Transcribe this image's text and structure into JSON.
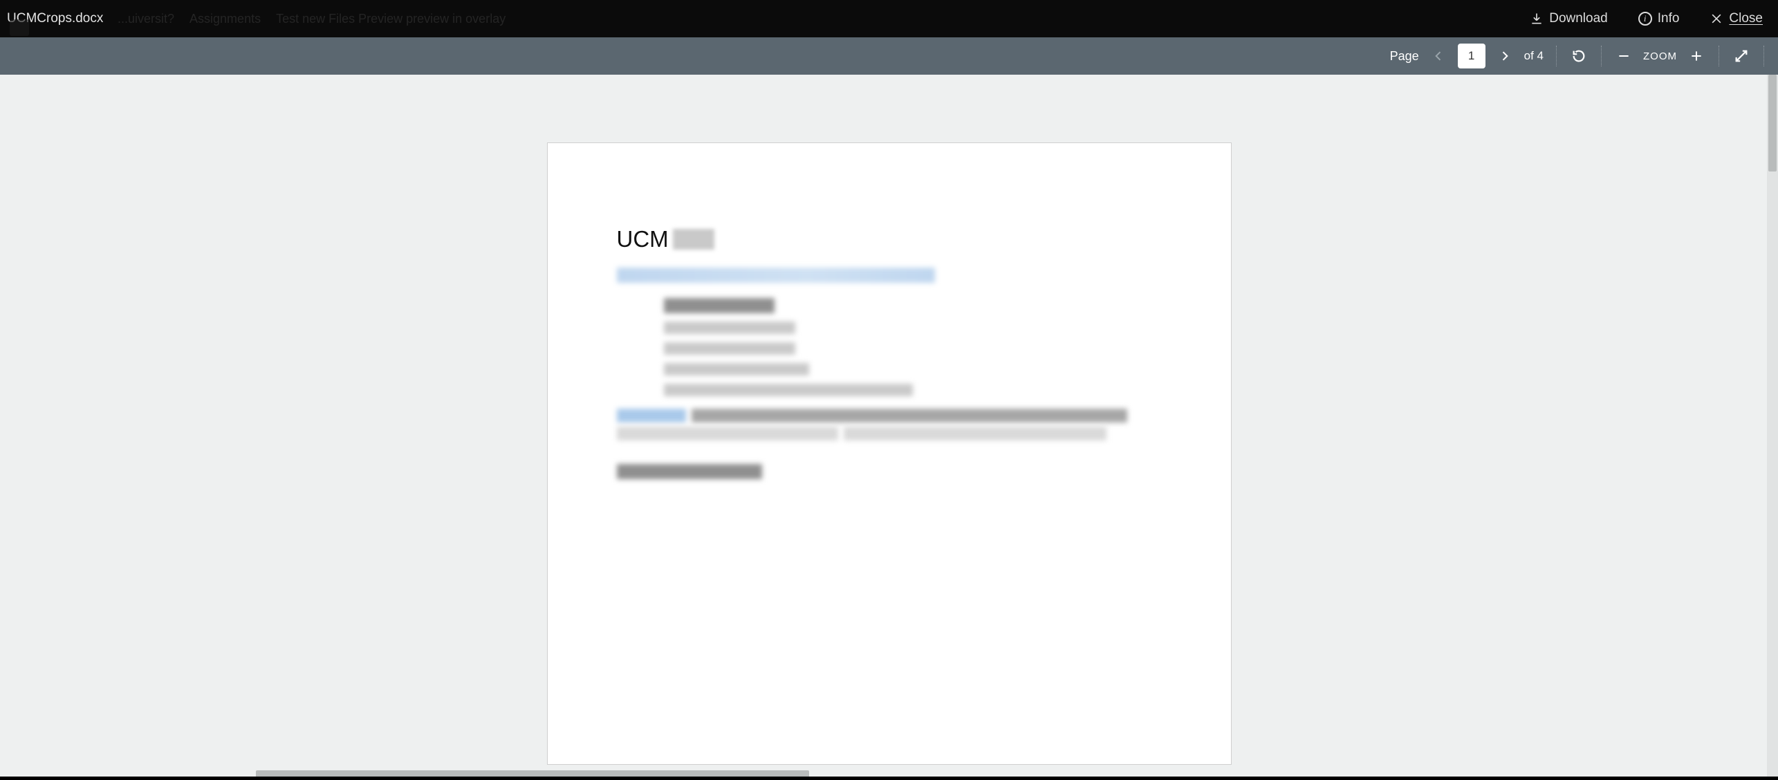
{
  "header": {
    "filename": "UCMCrops.docx",
    "breadcrumb_ghost": {
      "b1": "...uiversit?",
      "b2": "Assignments",
      "b3": "Test new Files Preview preview in overlay"
    },
    "actions": {
      "download": "Download",
      "info": "Info",
      "close": "Close"
    }
  },
  "viewer": {
    "page_label": "Page",
    "page_current": "1",
    "page_total_prefix": "of 4",
    "zoom_label": "ZOOM"
  },
  "document": {
    "title_visible": "UCM"
  }
}
